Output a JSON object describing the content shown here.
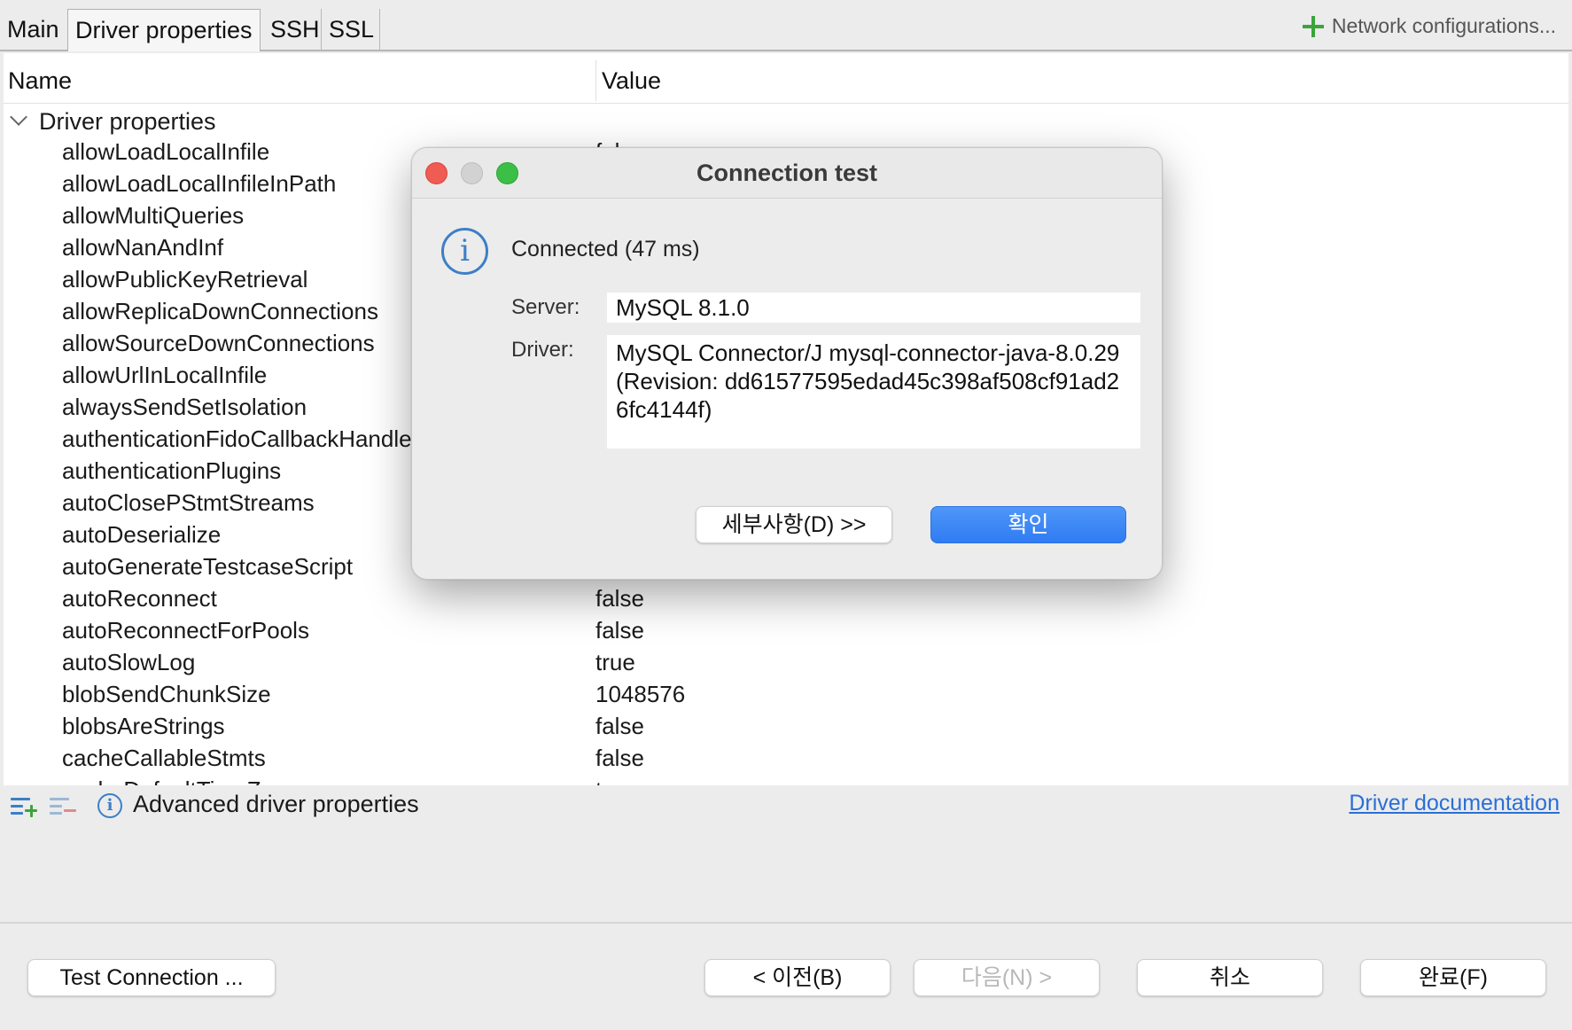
{
  "tabs": {
    "main": "Main",
    "driver_properties": "Driver properties",
    "ssh": "SSH",
    "ssl": "SSL",
    "network_configurations": "Network configurations..."
  },
  "table": {
    "col_name": "Name",
    "col_value": "Value",
    "group_label": "Driver properties",
    "rows": [
      {
        "name": "allowLoadLocalInfile",
        "value": "false"
      },
      {
        "name": "allowLoadLocalInfileInPath",
        "value": ""
      },
      {
        "name": "allowMultiQueries",
        "value": ""
      },
      {
        "name": "allowNanAndInf",
        "value": ""
      },
      {
        "name": "allowPublicKeyRetrieval",
        "value": ""
      },
      {
        "name": "allowReplicaDownConnections",
        "value": ""
      },
      {
        "name": "allowSourceDownConnections",
        "value": ""
      },
      {
        "name": "allowUrlInLocalInfile",
        "value": ""
      },
      {
        "name": "alwaysSendSetIsolation",
        "value": ""
      },
      {
        "name": "authenticationFidoCallbackHandler",
        "value": ""
      },
      {
        "name": "authenticationPlugins",
        "value": ""
      },
      {
        "name": "autoClosePStmtStreams",
        "value": ""
      },
      {
        "name": "autoDeserialize",
        "value": ""
      },
      {
        "name": "autoGenerateTestcaseScript",
        "value": ""
      },
      {
        "name": "autoReconnect",
        "value": "false"
      },
      {
        "name": "autoReconnectForPools",
        "value": "false"
      },
      {
        "name": "autoSlowLog",
        "value": "true"
      },
      {
        "name": "blobSendChunkSize",
        "value": "1048576"
      },
      {
        "name": "blobsAreStrings",
        "value": "false"
      },
      {
        "name": "cacheCallableStmts",
        "value": "false"
      },
      {
        "name": "cacheDefaultTimeZone",
        "value": "true"
      }
    ]
  },
  "lower_toolbar": {
    "advanced_label": "Advanced driver properties",
    "doc_link": "Driver documentation"
  },
  "buttons": {
    "test_connection": "Test Connection ...",
    "back": "< 이전(B)",
    "next": "다음(N) >",
    "cancel": "취소",
    "finish": "완료(F)"
  },
  "dialog": {
    "title": "Connection test",
    "status": "Connected (47 ms)",
    "server_label": "Server:",
    "server_value": "MySQL 8.1.0",
    "driver_label": "Driver:",
    "driver_value": "MySQL Connector/J mysql-connector-java-8.0.29 (Revision: dd61577595edad45c398af508cf91ad26fc4144f)",
    "details_button": "세부사항(D) >>",
    "ok_button": "확인"
  },
  "colors": {
    "accent_blue": "#2f7bf2",
    "link_blue": "#2a6fd6",
    "info_blue": "#3c7fc6",
    "plus_green": "#3ba43b",
    "close_red": "#ee5c54",
    "max_green": "#3cbf46"
  }
}
